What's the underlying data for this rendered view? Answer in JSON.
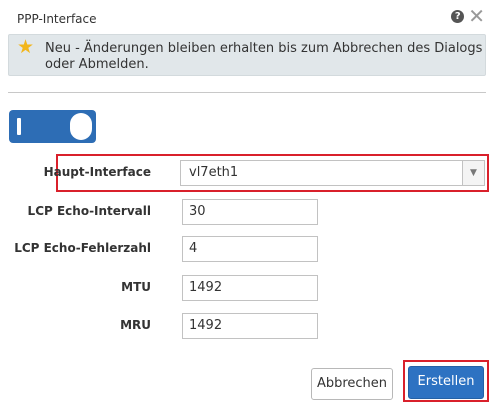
{
  "dialog": {
    "title": "PPP-Interface",
    "help_icon_char": "?",
    "close_icon_char": "✕"
  },
  "notice": {
    "icon": "star-icon",
    "text": "Neu - Änderungen bleiben erhalten bis zum Abbrechen des Dialogs oder Abmelden."
  },
  "toggle": {
    "state": "on"
  },
  "form": {
    "haupt_interface": {
      "label": "Haupt-Interface",
      "value": "vl7eth1"
    },
    "lcp_echo_intervall": {
      "label": "LCP Echo-Intervall",
      "value": "30"
    },
    "lcp_echo_fehlerzahl": {
      "label": "LCP Echo-Fehlerzahl",
      "value": "4"
    },
    "mtu": {
      "label": "MTU",
      "value": "1492"
    },
    "mru": {
      "label": "MRU",
      "value": "1492"
    }
  },
  "buttons": {
    "cancel": "Abbrechen",
    "create": "Erstellen"
  },
  "colors": {
    "accent": "#2d72c2",
    "highlight": "#d9202b",
    "notice_bg": "#e1e7ea",
    "star": "#f2b61b"
  }
}
